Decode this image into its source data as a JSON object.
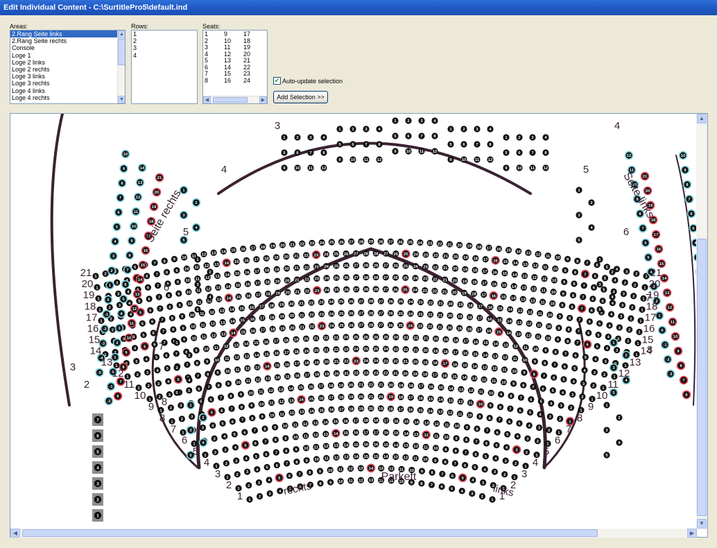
{
  "window": {
    "title": "Edit Individual Content - C:\\SurtitlePro5\\default.ind"
  },
  "areas": {
    "label": "Areas:",
    "items": [
      "2.Rang Seite links",
      "2.Rang Seite rechts",
      "Console",
      "Loge 1",
      "Loge 2 links",
      "Loge 2 rechts",
      "Loge 3 links",
      "Loge 3 rechts",
      "Loge 4 links",
      "Loge 4 rechts"
    ],
    "selected_index": 0
  },
  "rows": {
    "label": "Rows:",
    "items": [
      "1",
      "2",
      "3",
      "4"
    ]
  },
  "seats": {
    "label": "Seats:",
    "columns": [
      [
        "1",
        "2",
        "3",
        "4",
        "5",
        "6",
        "7",
        "8"
      ],
      [
        "9",
        "10",
        "11",
        "12",
        "13",
        "14",
        "15",
        "16"
      ],
      [
        "17",
        "18",
        "19",
        "20",
        "21",
        "22",
        "23",
        "24"
      ]
    ]
  },
  "auto_update": {
    "label": "Auto-update selection",
    "checked": true
  },
  "add_selection": {
    "label": "Add Selection >>"
  },
  "seat_map": {
    "section_labels": [
      "Seite rechts",
      "Seite links",
      "Parkett",
      "rechts",
      "links"
    ],
    "row_numbers_parkett": [
      "1",
      "2",
      "3",
      "4",
      "5",
      "6",
      "7",
      "8",
      "9",
      "10",
      "11",
      "12",
      "13",
      "14",
      "15",
      "16",
      "17",
      "18",
      "19",
      "20",
      "21"
    ],
    "loge_numbers": [
      "2",
      "3",
      "3",
      "4",
      "4",
      "5",
      "5",
      "6",
      "6",
      "7",
      "7",
      "8",
      "8"
    ],
    "console_seats": [
      "7",
      "6",
      "5",
      "4",
      "3",
      "2",
      "1"
    ],
    "colors": {
      "seat": "#111111",
      "seat_highlight_blue": "#7fd3df",
      "seat_highlight_red": "#e2485a",
      "seat_highlight_orange": "#f0a243",
      "wall": "#3b2232"
    }
  }
}
